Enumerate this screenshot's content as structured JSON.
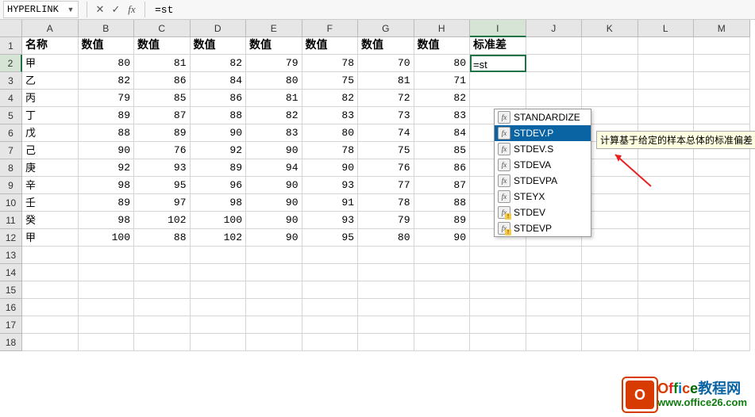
{
  "formula_bar": {
    "name_box": "HYPERLINK",
    "cancel_glyph": "✕",
    "confirm_glyph": "✓",
    "fx_glyph": "fx",
    "formula": "=st"
  },
  "columns": [
    "A",
    "B",
    "C",
    "D",
    "E",
    "F",
    "G",
    "H",
    "I",
    "J",
    "K",
    "L",
    "M"
  ],
  "active_col_index": 8,
  "rows": [
    1,
    2,
    3,
    4,
    5,
    6,
    7,
    8,
    9,
    10,
    11,
    12,
    13,
    14,
    15,
    16,
    17,
    18
  ],
  "active_row_index": 1,
  "header_row": [
    "名称",
    "数值",
    "数值",
    "数值",
    "数值",
    "数值",
    "数值",
    "数值",
    "标准差"
  ],
  "data_rows": [
    {
      "label": "甲",
      "vals": [
        80,
        81,
        82,
        79,
        78,
        70,
        80
      ],
      "edit": "=st"
    },
    {
      "label": "乙",
      "vals": [
        82,
        86,
        84,
        80,
        75,
        81,
        71
      ]
    },
    {
      "label": "丙",
      "vals": [
        79,
        85,
        86,
        81,
        82,
        72,
        82
      ]
    },
    {
      "label": "丁",
      "vals": [
        89,
        87,
        88,
        82,
        83,
        73,
        83
      ]
    },
    {
      "label": "戊",
      "vals": [
        88,
        89,
        90,
        83,
        80,
        74,
        84
      ]
    },
    {
      "label": "己",
      "vals": [
        90,
        76,
        92,
        90,
        78,
        75,
        85
      ]
    },
    {
      "label": "庚",
      "vals": [
        92,
        93,
        89,
        94,
        90,
        76,
        86
      ]
    },
    {
      "label": "辛",
      "vals": [
        98,
        95,
        96,
        90,
        93,
        77,
        87
      ]
    },
    {
      "label": "壬",
      "vals": [
        89,
        97,
        98,
        90,
        91,
        78,
        88
      ]
    },
    {
      "label": "癸",
      "vals": [
        98,
        102,
        100,
        90,
        93,
        79,
        89
      ]
    },
    {
      "label": "甲",
      "vals": [
        100,
        88,
        102,
        90,
        95,
        80,
        90
      ]
    }
  ],
  "autocomplete": {
    "items": [
      {
        "name": "STANDARDIZE",
        "warn": false
      },
      {
        "name": "STDEV.P",
        "warn": false,
        "selected": true
      },
      {
        "name": "STDEV.S",
        "warn": false
      },
      {
        "name": "STDEVA",
        "warn": false
      },
      {
        "name": "STDEVPA",
        "warn": false
      },
      {
        "name": "STEYX",
        "warn": false
      },
      {
        "name": "STDEV",
        "warn": true
      },
      {
        "name": "STDEVP",
        "warn": true
      }
    ],
    "tooltip": "计算基于给定的样本总体的标准偏差"
  },
  "watermark": {
    "title_chars": [
      "O",
      "f",
      "f",
      "i",
      "c",
      "e"
    ],
    "title_suffix": "教程网",
    "url": "www.office26.com",
    "logo_letter": "O"
  }
}
